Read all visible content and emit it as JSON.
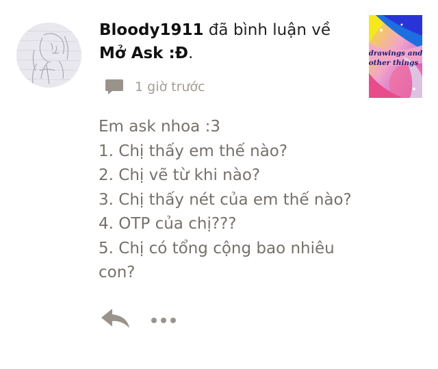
{
  "notification": {
    "username": "Bloody1911",
    "action_text": " đã bình luận về",
    "post_title": "Mở Ask :Đ",
    "post_title_suffix": ".",
    "timestamp": "1 giờ trước",
    "thumbnail_text": [
      "drawings and",
      "other things"
    ]
  },
  "comment": {
    "lines": [
      "Em ask nhoa :3",
      "1. Chị thấy em thế nào?",
      "2. Chị vẽ từ khi nào?",
      "3. Chị thấy nét của em thế nào?",
      "4. OTP của chị???",
      "5. Chị có tổng cộng bao nhiêu",
      "con?"
    ]
  },
  "icons": {
    "comment": "comment-bubble-icon",
    "reply": "reply-arrow-icon",
    "more": "more-dots-icon"
  },
  "colors": {
    "text_dark": "#111111",
    "text_body": "#75706a",
    "text_meta": "#a39c93",
    "icon": "#9a938b"
  }
}
